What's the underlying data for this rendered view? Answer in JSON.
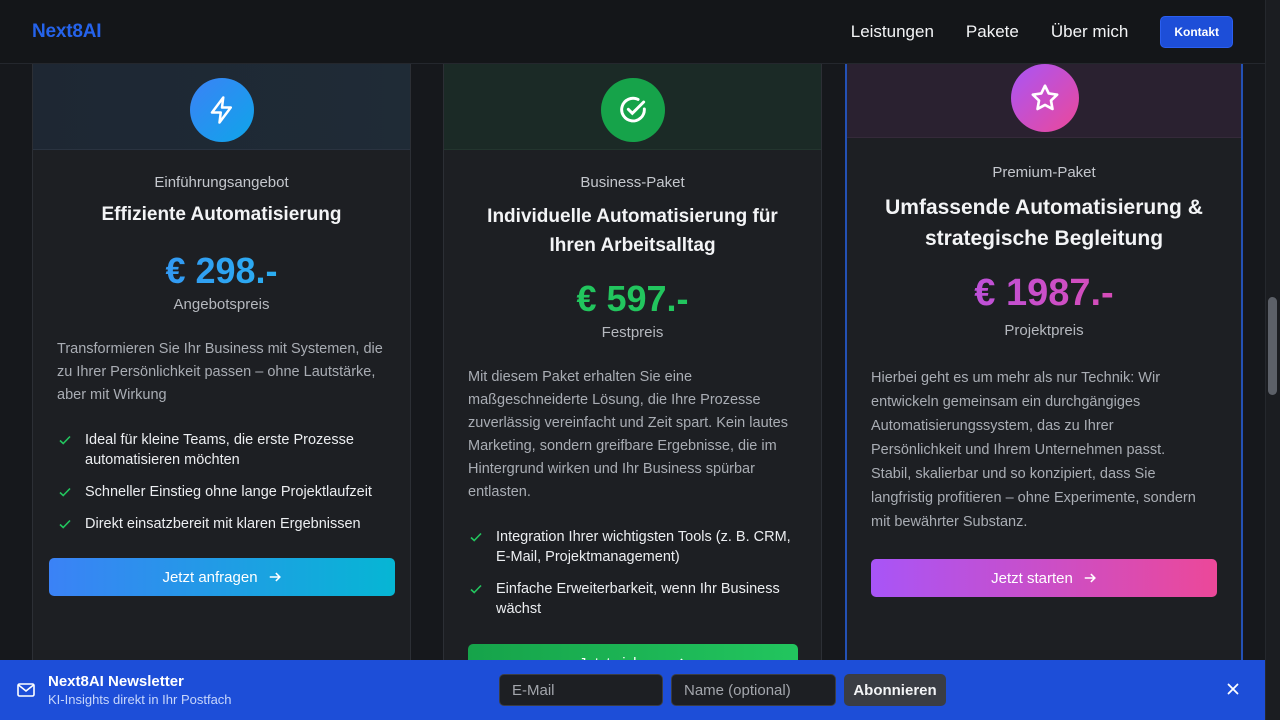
{
  "header": {
    "logo": "Next8AI",
    "nav": [
      "Leistungen",
      "Pakete",
      "Über mich"
    ],
    "contact_label": "Kontakt"
  },
  "cards": [
    {
      "label": "Einführungsangebot",
      "title": "Effiziente Automatisierung",
      "price": "€ 298.-",
      "price_sub": "Angebotspreis",
      "description": "Transformieren Sie Ihr Business mit Systemen, die zu Ihrer Persönlichkeit passen – ohne Lautstärke, aber mit Wirkung",
      "features": [
        "Ideal für kleine Teams, die erste Prozesse automatisieren möchten",
        "Schneller Einstieg ohne lange Projektlaufzeit",
        "Direkt einsatzbereit mit klaren Ergebnissen"
      ],
      "cta": "Jetzt anfragen",
      "icon": "lightning-icon",
      "accent": "#3b82f6"
    },
    {
      "label": "Business-Paket",
      "title": "Individuelle Automatisierung für Ihren Arbeitsalltag",
      "price": "€ 597.-",
      "price_sub": "Festpreis",
      "description": "Mit diesem Paket erhalten Sie eine maßgeschneiderte Lösung, die Ihre Prozesse zuverlässig vereinfacht und Zeit spart. Kein lautes Marketing, sondern greifbare Ergebnisse, die im Hintergrund wirken und Ihr Business spürbar entlasten.",
      "features": [
        "Integration Ihrer wichtigsten Tools (z. B. CRM, E-Mail, Projektmanagement)",
        "Einfache Erweiterbarkeit, wenn Ihr Business wächst"
      ],
      "cta": "Jetzt sichern",
      "icon": "check-circle-icon",
      "accent": "#22c55e"
    },
    {
      "label": "Premium-Paket",
      "title": "Umfassende Automatisierung & strategische Begleitung",
      "price": "€ 1987.-",
      "price_sub": "Projektpreis",
      "description": "Hierbei geht es um mehr als nur Technik: Wir entwickeln gemeinsam ein durchgängiges Automatisierungssystem, das zu Ihrer Persönlichkeit und Ihrem Unternehmen passt. Stabil, skalierbar und so konzipiert, dass Sie langfristig profitieren – ohne Experimente, sondern mit bewährter Substanz.",
      "cta": "Jetzt starten",
      "icon": "star-icon",
      "accent": "#ec4899"
    }
  ],
  "newsletter": {
    "title": "Next8AI Newsletter",
    "subtitle": "KI-Insights direkt in Ihr Postfach",
    "email_placeholder": "E-Mail",
    "name_placeholder": "Name (optional)",
    "button": "Abonnieren",
    "icon": "mail-icon",
    "close_icon": "close-icon"
  }
}
